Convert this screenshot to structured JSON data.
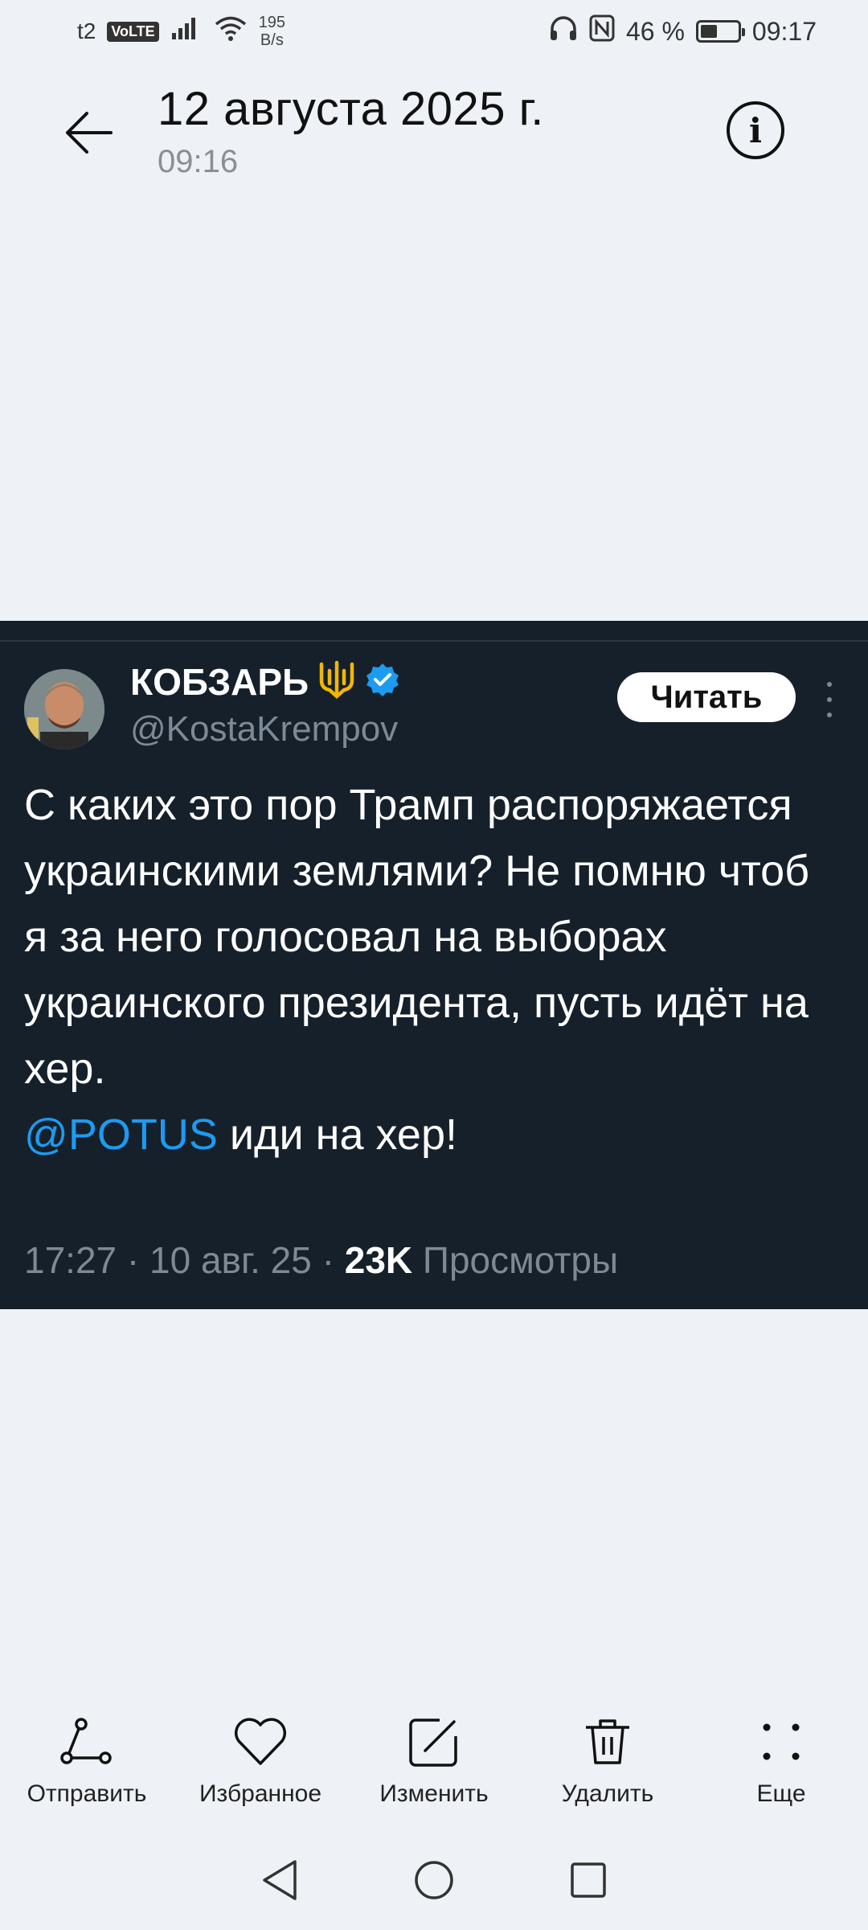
{
  "status_bar": {
    "carrier": "t2",
    "volte": "VoLTE",
    "net_speed_value": "195",
    "net_speed_unit": "B/s",
    "battery_text": "46 %",
    "battery_level": 0.46,
    "time": "09:17"
  },
  "header": {
    "title": "12 августа 2025 г.",
    "subtitle": "09:16",
    "info_glyph": "i"
  },
  "tweet": {
    "name": "КОБЗАРЬ",
    "handle": "@KostaKrempov",
    "follow_label": "Читать",
    "text": "С каких это пор Трамп распоряжается украинскими землями? Не помню чтоб я за него голосовал на выборах украинского президента, пусть идёт на хер.",
    "mention": "@POTUS",
    "mention_tail": " иди на хер!",
    "meta_time": "17:27 · 10 авг. 25 · ",
    "meta_views": "23K",
    "meta_views_label": " Просмотры",
    "colors": {
      "background": "#16202b",
      "mention": "#1d9bf0",
      "verified": "#1d9bf0",
      "trident": "#f2b705"
    }
  },
  "actions": [
    {
      "label": "Отправить",
      "icon": "share-icon"
    },
    {
      "label": "Избранное",
      "icon": "heart-icon"
    },
    {
      "label": "Изменить",
      "icon": "edit-icon"
    },
    {
      "label": "Удалить",
      "icon": "trash-icon"
    },
    {
      "label": "Еще",
      "icon": "more-icon"
    }
  ],
  "nav_bar": {
    "icons": [
      "back-triangle-icon",
      "home-circle-icon",
      "recents-square-icon"
    ]
  }
}
